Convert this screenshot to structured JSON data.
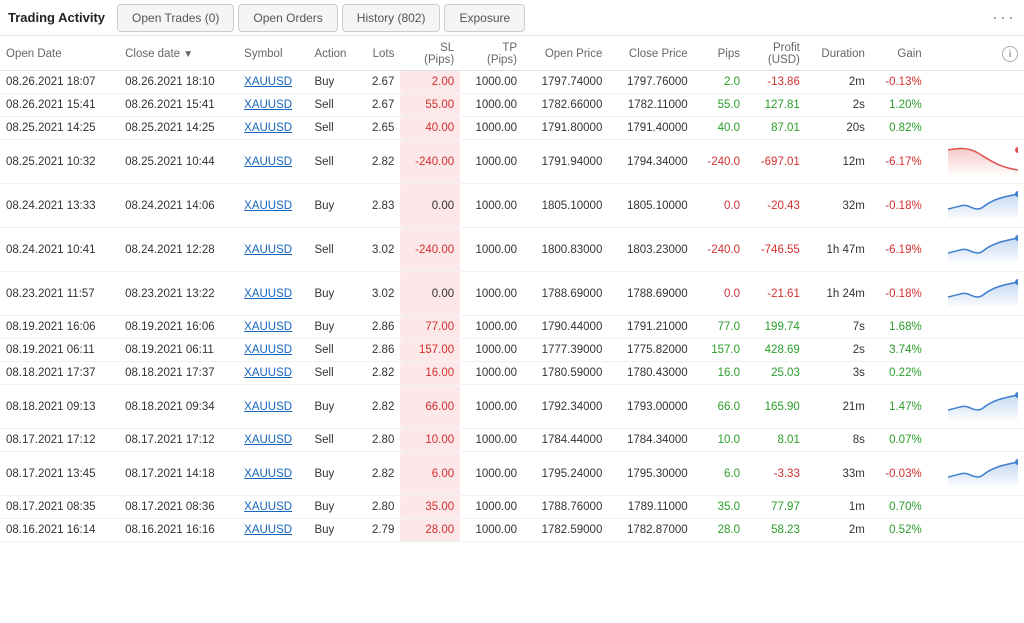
{
  "header": {
    "title": "Trading Activity",
    "tabs": [
      {
        "label": "Open Trades (0)",
        "key": "open-trades",
        "active": false
      },
      {
        "label": "Open Orders",
        "key": "open-orders",
        "active": false
      },
      {
        "label": "History (802)",
        "key": "history",
        "active": false
      },
      {
        "label": "Exposure",
        "key": "exposure",
        "active": false
      }
    ],
    "more_label": "···"
  },
  "table": {
    "columns": [
      {
        "label": "Open Date",
        "key": "open_date",
        "align": "left"
      },
      {
        "label": "Close date ▼",
        "key": "close_date",
        "align": "left"
      },
      {
        "label": "Symbol",
        "key": "symbol",
        "align": "left"
      },
      {
        "label": "Action",
        "key": "action",
        "align": "left"
      },
      {
        "label": "Lots",
        "key": "lots",
        "align": "right"
      },
      {
        "label": "SL (Pips)",
        "key": "sl",
        "align": "right"
      },
      {
        "label": "TP (Pips)",
        "key": "tp",
        "align": "right"
      },
      {
        "label": "Open Price",
        "key": "open_price",
        "align": "right"
      },
      {
        "label": "Close Price",
        "key": "close_price",
        "align": "right"
      },
      {
        "label": "Pips",
        "key": "pips",
        "align": "right"
      },
      {
        "label": "Profit (USD)",
        "key": "profit",
        "align": "right"
      },
      {
        "label": "Duration",
        "key": "duration",
        "align": "right"
      },
      {
        "label": "Gain",
        "key": "gain",
        "align": "right"
      },
      {
        "label": "",
        "key": "chart",
        "align": "right"
      }
    ],
    "rows": [
      {
        "open_date": "08.26.2021 18:07",
        "close_date": "08.26.2021 18:10",
        "symbol": "XAUUSD",
        "action": "Buy",
        "lots": "2.67",
        "sl": "2.00",
        "tp": "1000.00",
        "open_price": "1797.74000",
        "close_price": "1797.76000",
        "pips": "2.0",
        "profit": "-13.86",
        "duration": "2m",
        "gain": "-0.13%",
        "sl_negative": false,
        "profit_negative": true,
        "pips_positive": true,
        "has_chart": false
      },
      {
        "open_date": "08.26.2021 15:41",
        "close_date": "08.26.2021 15:41",
        "symbol": "XAUUSD",
        "action": "Sell",
        "lots": "2.67",
        "sl": "55.00",
        "tp": "1000.00",
        "open_price": "1782.66000",
        "close_price": "1782.11000",
        "pips": "55.0",
        "profit": "127.81",
        "duration": "2s",
        "gain": "1.20%",
        "sl_negative": false,
        "profit_negative": false,
        "pips_positive": true,
        "has_chart": false
      },
      {
        "open_date": "08.25.2021 14:25",
        "close_date": "08.25.2021 14:25",
        "symbol": "XAUUSD",
        "action": "Sell",
        "lots": "2.65",
        "sl": "40.00",
        "tp": "1000.00",
        "open_price": "1791.80000",
        "close_price": "1791.40000",
        "pips": "40.0",
        "profit": "87.01",
        "duration": "20s",
        "gain": "0.82%",
        "sl_negative": false,
        "profit_negative": false,
        "pips_positive": true,
        "has_chart": false
      },
      {
        "open_date": "08.25.2021 10:32",
        "close_date": "08.25.2021 10:44",
        "symbol": "XAUUSD",
        "action": "Sell",
        "lots": "2.82",
        "sl": "-240.00",
        "tp": "1000.00",
        "open_price": "1791.94000",
        "close_price": "1794.34000",
        "pips": "-240.0",
        "profit": "-697.01",
        "duration": "12m",
        "gain": "-6.17%",
        "sl_negative": true,
        "profit_negative": true,
        "pips_positive": false,
        "has_chart": true,
        "chart_type": "red"
      },
      {
        "open_date": "08.24.2021 13:33",
        "close_date": "08.24.2021 14:06",
        "symbol": "XAUUSD",
        "action": "Buy",
        "lots": "2.83",
        "sl": "0.00",
        "tp": "1000.00",
        "open_price": "1805.10000",
        "close_price": "1805.10000",
        "pips": "0.0",
        "profit": "-20.43",
        "duration": "32m",
        "gain": "-0.18%",
        "sl_negative": false,
        "profit_negative": true,
        "pips_positive": false,
        "has_chart": true,
        "chart_type": "blue"
      },
      {
        "open_date": "08.24.2021 10:41",
        "close_date": "08.24.2021 12:28",
        "symbol": "XAUUSD",
        "action": "Sell",
        "lots": "3.02",
        "sl": "-240.00",
        "tp": "1000.00",
        "open_price": "1800.83000",
        "close_price": "1803.23000",
        "pips": "-240.0",
        "profit": "-746.55",
        "duration": "1h 47m",
        "gain": "-6.19%",
        "sl_negative": true,
        "profit_negative": true,
        "pips_positive": false,
        "has_chart": true,
        "chart_type": "blue2"
      },
      {
        "open_date": "08.23.2021 11:57",
        "close_date": "08.23.2021 13:22",
        "symbol": "XAUUSD",
        "action": "Buy",
        "lots": "3.02",
        "sl": "0.00",
        "tp": "1000.00",
        "open_price": "1788.69000",
        "close_price": "1788.69000",
        "pips": "0.0",
        "profit": "-21.61",
        "duration": "1h 24m",
        "gain": "-0.18%",
        "sl_negative": false,
        "profit_negative": true,
        "pips_positive": false,
        "has_chart": true,
        "chart_type": "blue3"
      },
      {
        "open_date": "08.19.2021 16:06",
        "close_date": "08.19.2021 16:06",
        "symbol": "XAUUSD",
        "action": "Buy",
        "lots": "2.86",
        "sl": "77.00",
        "tp": "1000.00",
        "open_price": "1790.44000",
        "close_price": "1791.21000",
        "pips": "77.0",
        "profit": "199.74",
        "duration": "7s",
        "gain": "1.68%",
        "sl_negative": false,
        "profit_negative": false,
        "pips_positive": true,
        "has_chart": false
      },
      {
        "open_date": "08.19.2021 06:11",
        "close_date": "08.19.2021 06:11",
        "symbol": "XAUUSD",
        "action": "Sell",
        "lots": "2.86",
        "sl": "157.00",
        "tp": "1000.00",
        "open_price": "1777.39000",
        "close_price": "1775.82000",
        "pips": "157.0",
        "profit": "428.69",
        "duration": "2s",
        "gain": "3.74%",
        "sl_negative": false,
        "profit_negative": false,
        "pips_positive": true,
        "has_chart": false
      },
      {
        "open_date": "08.18.2021 17:37",
        "close_date": "08.18.2021 17:37",
        "symbol": "XAUUSD",
        "action": "Sell",
        "lots": "2.82",
        "sl": "16.00",
        "tp": "1000.00",
        "open_price": "1780.59000",
        "close_price": "1780.43000",
        "pips": "16.0",
        "profit": "25.03",
        "duration": "3s",
        "gain": "0.22%",
        "sl_negative": false,
        "profit_negative": false,
        "pips_positive": true,
        "has_chart": false
      },
      {
        "open_date": "08.18.2021 09:13",
        "close_date": "08.18.2021 09:34",
        "symbol": "XAUUSD",
        "action": "Buy",
        "lots": "2.82",
        "sl": "66.00",
        "tp": "1000.00",
        "open_price": "1792.34000",
        "close_price": "1793.00000",
        "pips": "66.0",
        "profit": "165.90",
        "duration": "21m",
        "gain": "1.47%",
        "sl_negative": false,
        "profit_negative": false,
        "pips_positive": true,
        "has_chart": true,
        "chart_type": "blue4"
      },
      {
        "open_date": "08.17.2021 17:12",
        "close_date": "08.17.2021 17:12",
        "symbol": "XAUUSD",
        "action": "Sell",
        "lots": "2.80",
        "sl": "10.00",
        "tp": "1000.00",
        "open_price": "1784.44000",
        "close_price": "1784.34000",
        "pips": "10.0",
        "profit": "8.01",
        "duration": "8s",
        "gain": "0.07%",
        "sl_negative": false,
        "profit_negative": false,
        "pips_positive": true,
        "has_chart": false
      },
      {
        "open_date": "08.17.2021 13:45",
        "close_date": "08.17.2021 14:18",
        "symbol": "XAUUSD",
        "action": "Buy",
        "lots": "2.82",
        "sl": "6.00",
        "tp": "1000.00",
        "open_price": "1795.24000",
        "close_price": "1795.30000",
        "pips": "6.0",
        "profit": "-3.33",
        "duration": "33m",
        "gain": "-0.03%",
        "sl_negative": false,
        "profit_negative": true,
        "pips_positive": true,
        "has_chart": true,
        "chart_type": "blue5"
      },
      {
        "open_date": "08.17.2021 08:35",
        "close_date": "08.17.2021 08:36",
        "symbol": "XAUUSD",
        "action": "Buy",
        "lots": "2.80",
        "sl": "35.00",
        "tp": "1000.00",
        "open_price": "1788.76000",
        "close_price": "1789.11000",
        "pips": "35.0",
        "profit": "77.97",
        "duration": "1m",
        "gain": "0.70%",
        "sl_negative": false,
        "profit_negative": false,
        "pips_positive": true,
        "has_chart": false
      },
      {
        "open_date": "08.16.2021 16:14",
        "close_date": "08.16.2021 16:16",
        "symbol": "XAUUSD",
        "action": "Buy",
        "lots": "2.79",
        "sl": "28.00",
        "tp": "1000.00",
        "open_price": "1782.59000",
        "close_price": "1782.87000",
        "pips": "28.0",
        "profit": "58.23",
        "duration": "2m",
        "gain": "0.52%",
        "sl_negative": false,
        "profit_negative": false,
        "pips_positive": true,
        "has_chart": false
      }
    ]
  }
}
